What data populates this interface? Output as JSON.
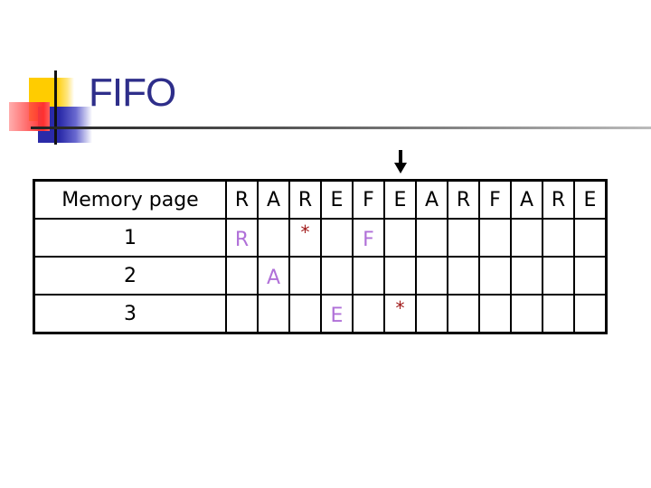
{
  "title": "FIFO",
  "marker": {
    "icon": "down-arrow-icon",
    "column_index": 5
  },
  "table": {
    "header_label": "Memory page",
    "sequence": [
      "R",
      "A",
      "R",
      "E",
      "F",
      "E",
      "A",
      "R",
      "F",
      "A",
      "R",
      "E"
    ],
    "rows": [
      {
        "label": "1",
        "cells": [
          {
            "text": "R",
            "type": "val"
          },
          {
            "text": "",
            "type": ""
          },
          {
            "text": "*",
            "type": "star"
          },
          {
            "text": "",
            "type": ""
          },
          {
            "text": "F",
            "type": "val"
          },
          {
            "text": "",
            "type": ""
          },
          {
            "text": "",
            "type": ""
          },
          {
            "text": "",
            "type": ""
          },
          {
            "text": "",
            "type": ""
          },
          {
            "text": "",
            "type": ""
          },
          {
            "text": "",
            "type": ""
          },
          {
            "text": "",
            "type": ""
          }
        ]
      },
      {
        "label": "2",
        "cells": [
          {
            "text": "",
            "type": ""
          },
          {
            "text": "A",
            "type": "val"
          },
          {
            "text": "",
            "type": ""
          },
          {
            "text": "",
            "type": ""
          },
          {
            "text": "",
            "type": ""
          },
          {
            "text": "",
            "type": ""
          },
          {
            "text": "",
            "type": ""
          },
          {
            "text": "",
            "type": ""
          },
          {
            "text": "",
            "type": ""
          },
          {
            "text": "",
            "type": ""
          },
          {
            "text": "",
            "type": ""
          },
          {
            "text": "",
            "type": ""
          }
        ]
      },
      {
        "label": "3",
        "cells": [
          {
            "text": "",
            "type": ""
          },
          {
            "text": "",
            "type": ""
          },
          {
            "text": "",
            "type": ""
          },
          {
            "text": "E",
            "type": "val"
          },
          {
            "text": "",
            "type": ""
          },
          {
            "text": "*",
            "type": "star"
          },
          {
            "text": "",
            "type": ""
          },
          {
            "text": "",
            "type": ""
          },
          {
            "text": "",
            "type": ""
          },
          {
            "text": "",
            "type": ""
          },
          {
            "text": "",
            "type": ""
          },
          {
            "text": "",
            "type": ""
          }
        ]
      }
    ]
  },
  "colors": {
    "title": "#2e2e8a",
    "value": "#b070d8",
    "star": "#a01818"
  }
}
